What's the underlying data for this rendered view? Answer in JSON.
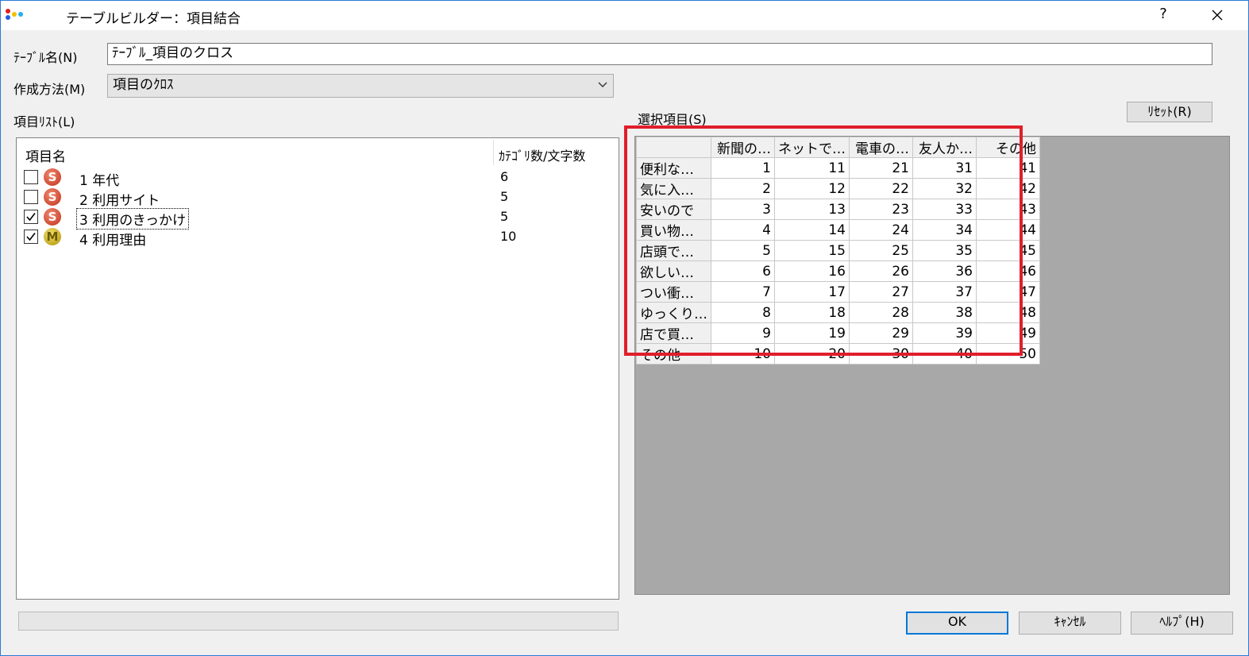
{
  "window": {
    "title": "テーブルビルダー：項目結合",
    "help_label": "?"
  },
  "form": {
    "table_name_label": "ﾃｰﾌﾞﾙ名(N)",
    "table_name_value": "ﾃｰﾌﾞﾙ_項目のクロス",
    "method_label": "作成方法(M)",
    "method_value": "項目のｸﾛｽ",
    "item_list_label": "項目ﾘｽﾄ(L)",
    "selected_label": "選択項目(S)",
    "reset_label": "ﾘｾｯﾄ(R)"
  },
  "item_list": {
    "col_name": "項目名",
    "col_count": "ｶﾃｺﾞﾘ数/文字数",
    "rows": [
      {
        "checked": false,
        "type": "S",
        "label": "1 年代",
        "count": "6"
      },
      {
        "checked": false,
        "type": "S",
        "label": "2 利用サイト",
        "count": "5"
      },
      {
        "checked": true,
        "type": "S",
        "label": "3 利用のきっかけ",
        "count": "5"
      },
      {
        "checked": true,
        "type": "M",
        "label": "4 利用理由",
        "count": "10"
      }
    ]
  },
  "grid": {
    "columns": [
      "新聞の…",
      "ネットで…",
      "電車の…",
      "友人か…",
      "その他"
    ],
    "rows": [
      {
        "label": "便利な…",
        "values": [
          "1",
          "11",
          "21",
          "31",
          "41"
        ]
      },
      {
        "label": "気に入…",
        "values": [
          "2",
          "12",
          "22",
          "32",
          "42"
        ]
      },
      {
        "label": "安いので",
        "values": [
          "3",
          "13",
          "23",
          "33",
          "43"
        ]
      },
      {
        "label": "買い物…",
        "values": [
          "4",
          "14",
          "24",
          "34",
          "44"
        ]
      },
      {
        "label": "店頭で…",
        "values": [
          "5",
          "15",
          "25",
          "35",
          "45"
        ]
      },
      {
        "label": "欲しい…",
        "values": [
          "6",
          "16",
          "26",
          "36",
          "46"
        ]
      },
      {
        "label": "つい衝…",
        "values": [
          "7",
          "17",
          "27",
          "37",
          "47"
        ]
      },
      {
        "label": "ゆっくり…",
        "values": [
          "8",
          "18",
          "28",
          "38",
          "48"
        ]
      },
      {
        "label": "店で買…",
        "values": [
          "9",
          "19",
          "29",
          "39",
          "49"
        ]
      },
      {
        "label": "その他",
        "values": [
          "10",
          "20",
          "30",
          "40",
          "50"
        ]
      }
    ]
  },
  "buttons": {
    "ok": "OK",
    "cancel": "ｷｬﾝｾﾙ",
    "help": "ﾍﾙﾌﾟ(H)"
  },
  "colors": {
    "accent": "#0078d7",
    "highlight": "#e01e2b",
    "badge_s": "#c0301a",
    "badge_m": "#b09000"
  }
}
